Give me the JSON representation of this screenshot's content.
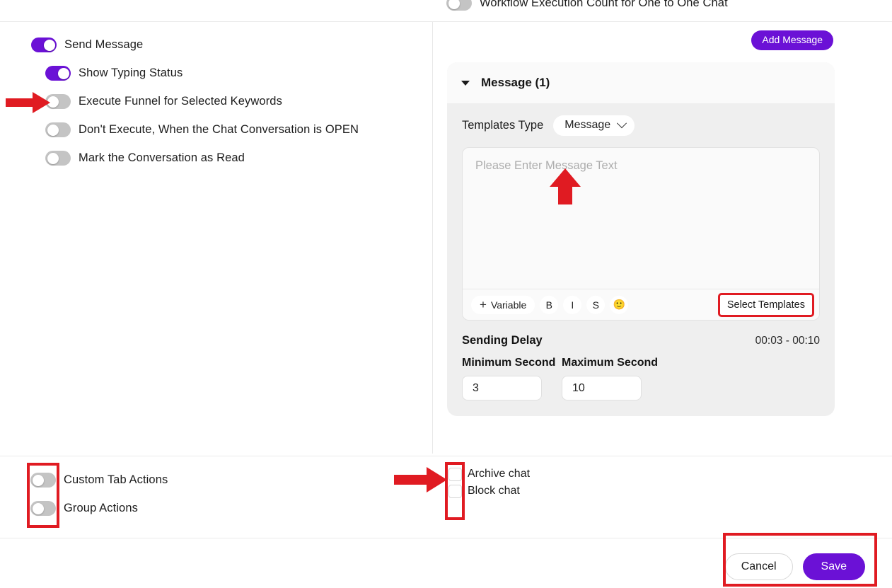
{
  "top_partial": {
    "toggle_state": "off",
    "label": "Workflow Execution Count for One to One Chat"
  },
  "toolbar": {
    "add_message_label": "Add Message"
  },
  "left_panel": {
    "toggles": [
      {
        "label": "Send Message",
        "state": "on"
      },
      {
        "label": "Show Typing Status",
        "state": "on"
      },
      {
        "label": "Execute Funnel for Selected Keywords",
        "state": "off"
      },
      {
        "label": "Don't Execute, When the Chat Conversation is OPEN",
        "state": "off"
      },
      {
        "label": "Mark the Conversation as Read",
        "state": "off"
      }
    ],
    "bottom_toggles": [
      {
        "label": "Custom Tab Actions",
        "state": "off"
      },
      {
        "label": "Group Actions",
        "state": "off"
      }
    ]
  },
  "message_card": {
    "title": "Message (1)",
    "collapse_icon": "caret-down-icon",
    "templates_type_label": "Templates Type",
    "templates_type_value": "Message",
    "editor_placeholder": "Please Enter Message Text",
    "editor_value": "",
    "editor_toolbar": {
      "variable_label": "Variable",
      "bold_label": "B",
      "italic_label": "I",
      "strike_label": "S",
      "emoji_glyph": "🙂",
      "select_templates_label": "Select Templates"
    },
    "sending_delay": {
      "title": "Sending Delay",
      "range": "00:03 - 00:10",
      "min_label": "Minimum Second",
      "min_value": "3",
      "max_label": "Maximum Second",
      "max_value": "10"
    }
  },
  "chat_actions": {
    "items": [
      {
        "label": "Archive chat",
        "checked": false
      },
      {
        "label": "Block chat",
        "checked": false
      }
    ]
  },
  "footer": {
    "cancel_label": "Cancel",
    "save_label": "Save"
  },
  "colors": {
    "accent_purple": "#6b11d6",
    "annotation_red": "#e01b22",
    "card_body_gray": "#efefef",
    "card_header_gray": "#fafafa",
    "toggle_off_gray": "#c4c4c4"
  }
}
